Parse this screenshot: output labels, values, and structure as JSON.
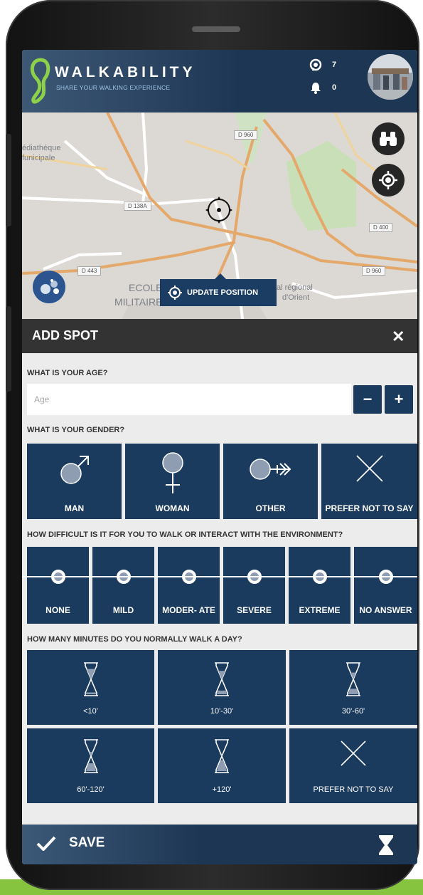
{
  "header": {
    "brand": "WALKABILITY",
    "tagline": "SHARE YOUR WALKING EXPERIENCE",
    "spots_count": "7",
    "notifications_count": "0"
  },
  "map": {
    "labels": {
      "mediatheque": "édiathèque",
      "municipale": "funicipale",
      "ecole": "ECOLE",
      "militaire": "MILITAIRE",
      "regional": "al régional",
      "orient": "d'Orient"
    },
    "roads": [
      "D 960",
      "D 138A",
      "D 443",
      "D 400",
      "D 960"
    ],
    "update_label": "UPDATE POSITION"
  },
  "sheet": {
    "title": "ADD SPOT",
    "close": "✕"
  },
  "age": {
    "question": "WHAT IS YOUR AGE?",
    "placeholder": "Age",
    "minus": "−",
    "plus": "+"
  },
  "gender": {
    "question": "WHAT IS YOUR GENDER?",
    "options": [
      "MAN",
      "WOMAN",
      "OTHER",
      "PREFER NOT TO SAY"
    ]
  },
  "difficulty": {
    "question": "HOW DIFFICULT IS IT FOR YOU TO WALK OR INTERACT WITH THE ENVIRONMENT?",
    "options": [
      "NONE",
      "MILD",
      "MODER- ATE",
      "SEVERE",
      "EXTREME",
      "NO ANSWER"
    ]
  },
  "minutes": {
    "question": "HOW MANY MINUTES DO YOU NORMALLY WALK A DAY?",
    "options": [
      "<10'",
      "10'-30'",
      "30'-60'",
      "60'-120'",
      "+120'",
      "PREFER NOT TO SAY"
    ],
    "fill_levels": [
      0.15,
      0.3,
      0.45,
      0.65,
      0.9
    ]
  },
  "footer": {
    "save_label": "SAVE"
  },
  "colors": {
    "tile": "#1a3a5e",
    "header": "#1d3654",
    "accent_green": "#86c440",
    "bar_dark": "#333333"
  }
}
